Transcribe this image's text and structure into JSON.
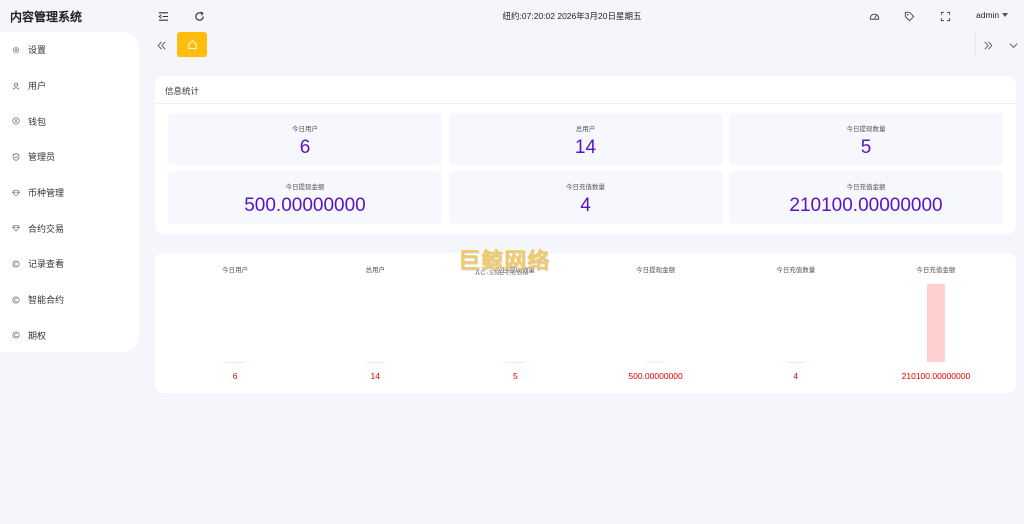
{
  "app": {
    "title": "内容管理系统"
  },
  "sidebar": {
    "items": [
      {
        "label": "设置",
        "icon": "gear-icon"
      },
      {
        "label": "用户",
        "icon": "user-icon"
      },
      {
        "label": "钱包",
        "icon": "wallet-icon"
      },
      {
        "label": "管理员",
        "icon": "shield-icon"
      },
      {
        "label": "币种管理",
        "icon": "diamond-icon"
      },
      {
        "label": "合约交易",
        "icon": "diamond-icon"
      },
      {
        "label": "记录查看",
        "icon": "coin-icon"
      },
      {
        "label": "智能合约",
        "icon": "coin-icon"
      },
      {
        "label": "期权",
        "icon": "coin-icon"
      }
    ]
  },
  "header": {
    "clock": "纽约:07:20:02 2026年3月20日星期五",
    "user": "admin"
  },
  "stats": {
    "title": "信息统计",
    "cards": [
      {
        "label": "今日用户",
        "value": "6"
      },
      {
        "label": "总用户",
        "value": "14"
      },
      {
        "label": "今日提现数量",
        "value": "5"
      },
      {
        "label": "今日提现金额",
        "value": "500.00000000"
      },
      {
        "label": "今日充值数量",
        "value": "4"
      },
      {
        "label": "今日充值金额",
        "value": "210100.00000000"
      }
    ]
  },
  "chart_data": {
    "type": "bar",
    "categories": [
      "今日用户",
      "总用户",
      "今日提现数量",
      "今日提现金额",
      "今日充值数量",
      "今日充值金额"
    ],
    "values": [
      6,
      14,
      5,
      500,
      4,
      210100
    ],
    "value_labels": [
      "6",
      "14",
      "5",
      "500.00000000",
      "4",
      "210100.00000000"
    ],
    "bar_color": "#ffcfcf",
    "label_color": "#e60000"
  },
  "watermark": {
    "main": "巨鲸网络",
    "sub": "AC-SNET.COM"
  },
  "colors": {
    "accent": "#ffbe0b",
    "value": "#5b12c6"
  }
}
